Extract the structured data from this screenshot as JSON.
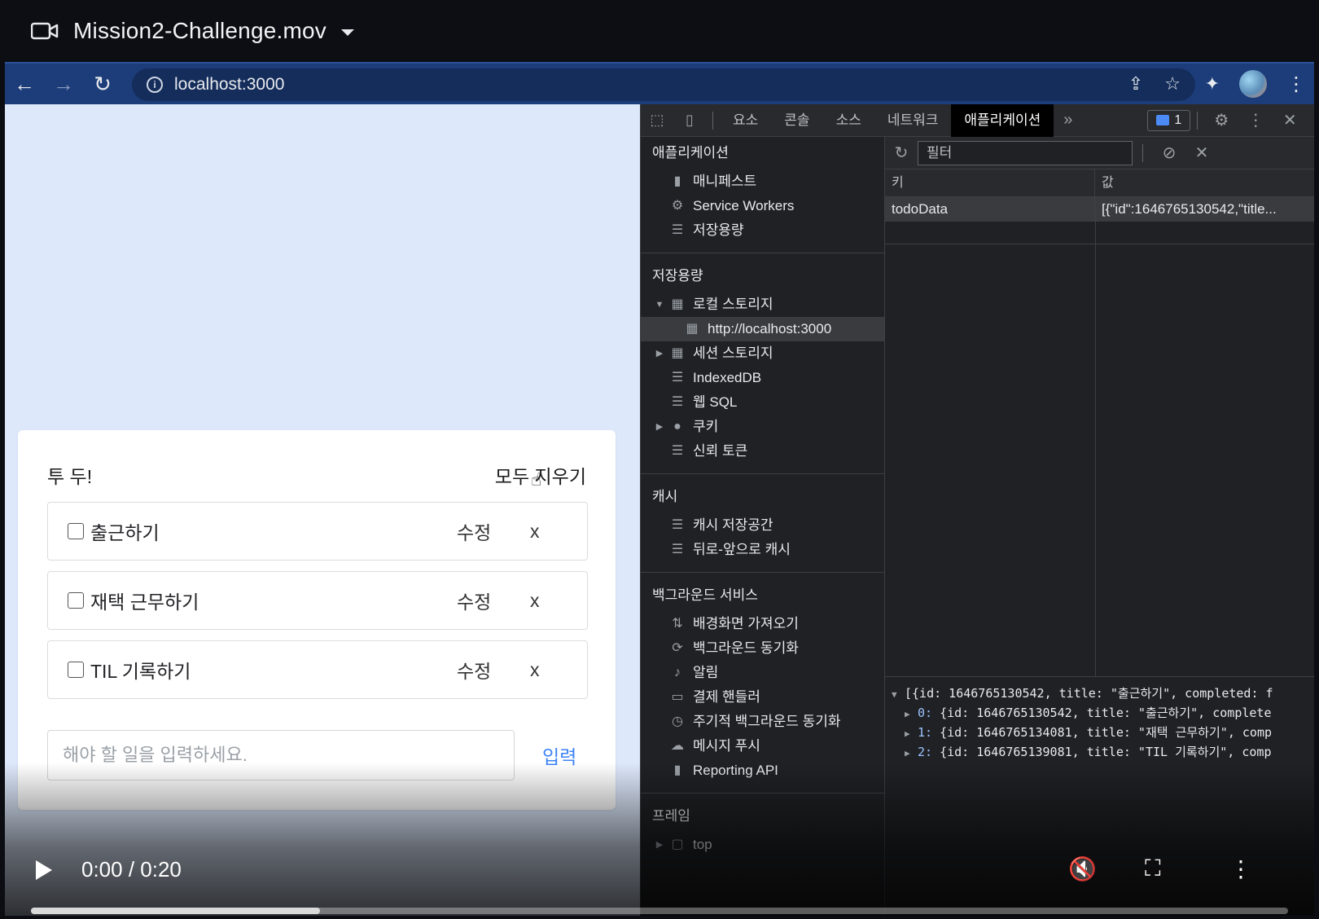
{
  "window": {
    "title": "Mission2-Challenge.mov",
    "icon": "video-camera-icon"
  },
  "browser": {
    "url": "localhost:3000",
    "icons": [
      "back-arrow-icon",
      "forward-arrow-icon",
      "reload-icon",
      "info-icon",
      "share-icon",
      "star-icon",
      "extensions-icon",
      "avatar",
      "menu-icon"
    ]
  },
  "todo_app": {
    "title": "투 두!",
    "clear_all": "모두 지우기",
    "items": [
      {
        "label": "출근하기",
        "edit": "수정",
        "delete": "x",
        "checked": false
      },
      {
        "label": "재택 근무하기",
        "edit": "수정",
        "delete": "x",
        "checked": false
      },
      {
        "label": "TIL 기록하기",
        "edit": "수정",
        "delete": "x",
        "checked": false
      }
    ],
    "input_placeholder": "해야 할 일을 입력하세요.",
    "submit": "입력"
  },
  "devtools": {
    "tabs": [
      "요소",
      "콘솔",
      "소스",
      "네트워크",
      "애플리케이션"
    ],
    "active_tab": "애플리케이션",
    "more": "»",
    "issues_count": "1",
    "sidebar": {
      "application": {
        "title": "애플리케이션",
        "items": [
          "매니페스트",
          "Service Workers",
          "저장용량"
        ]
      },
      "storage": {
        "title": "저장용량",
        "local_storage": "로컬 스토리지",
        "local_origin": "http://localhost:3000",
        "session_storage": "세션 스토리지",
        "indexeddb": "IndexedDB",
        "websql": "웹 SQL",
        "cookies": "쿠키",
        "trust_tokens": "신뢰 토큰"
      },
      "cache": {
        "title": "캐시",
        "items": [
          "캐시 저장공간",
          "뒤로-앞으로 캐시"
        ]
      },
      "background": {
        "title": "백그라운드 서비스",
        "items": [
          "배경화면 가져오기",
          "백그라운드 동기화",
          "알림",
          "결제 핸들러",
          "주기적 백그라운드 동기화",
          "메시지 푸시",
          "Reporting API"
        ]
      },
      "frames": {
        "title": "프레임",
        "top": "top"
      }
    },
    "filter_placeholder": "필터",
    "table": {
      "key_header": "키",
      "value_header": "값",
      "rows": [
        {
          "key": "todoData",
          "value": "[{\"id\":1646765130542,\"title..."
        }
      ]
    },
    "console_lines": [
      {
        "idx": "",
        "text": "[{id: 1646765130542, title: \"출근하기\", completed: f"
      },
      {
        "idx": "0:",
        "text": " {id: 1646765130542, title: \"출근하기\", complete"
      },
      {
        "idx": "1:",
        "text": " {id: 1646765134081, title: \"재택 근무하기\", comp"
      },
      {
        "idx": "2:",
        "text": " {id: 1646765139081, title: \"TIL 기록하기\", comp"
      }
    ]
  },
  "video": {
    "time": "0:00 / 0:20",
    "progress": 0.23,
    "muted": true
  }
}
